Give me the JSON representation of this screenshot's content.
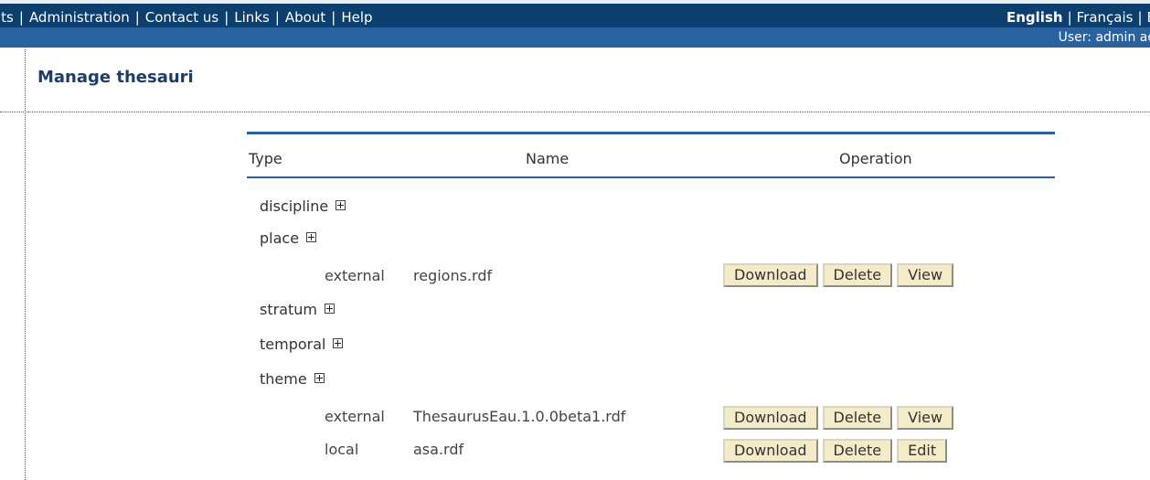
{
  "nav": {
    "items": [
      "lts",
      "Administration",
      "Contact us",
      "Links",
      "About",
      "Help"
    ]
  },
  "languages": {
    "active": "English",
    "other": "Français",
    "third": "E"
  },
  "user": {
    "label": "User: admin adr"
  },
  "page": {
    "title": "Manage thesauri"
  },
  "table": {
    "headers": {
      "type": "Type",
      "name": "Name",
      "operation": "Operation"
    },
    "types": [
      "discipline",
      "place",
      "stratum",
      "temporal",
      "theme"
    ],
    "entries": [
      {
        "kind": "external",
        "name": "regions.rdf",
        "ops": [
          "Download",
          "Delete",
          "View"
        ]
      },
      {
        "kind": "external",
        "name": "ThesaurusEau.1.0.0beta1.rdf",
        "ops": [
          "Download",
          "Delete",
          "View"
        ]
      },
      {
        "kind": "local",
        "name": "asa.rdf",
        "ops": [
          "Download",
          "Delete",
          "Edit"
        ]
      }
    ]
  },
  "icons": {
    "expand": "plus-box-icon"
  }
}
